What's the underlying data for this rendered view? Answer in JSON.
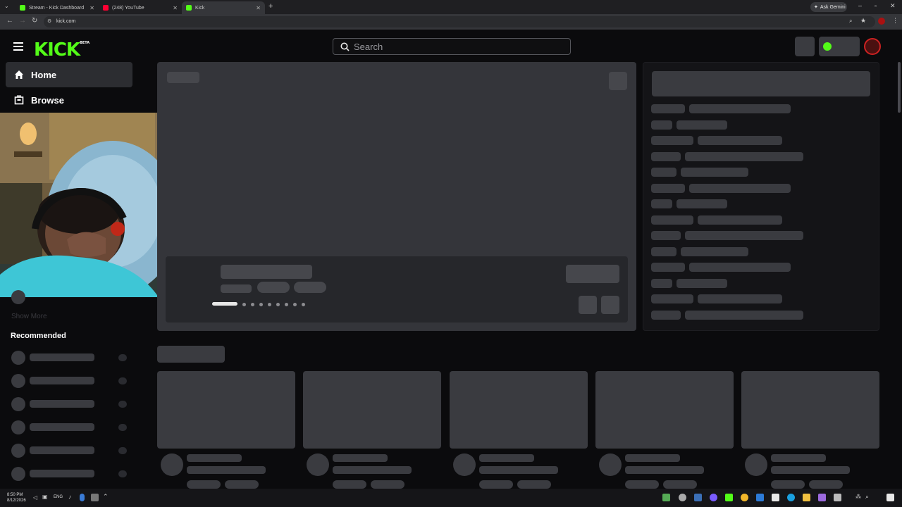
{
  "browser": {
    "tabs": [
      {
        "title": "Stream - Kick Dashboard",
        "fav_color": "#53fc18"
      },
      {
        "title": "(248) YouTube",
        "fav_color": "#ff0033"
      },
      {
        "title": "Kick",
        "fav_color": "#53fc18"
      }
    ],
    "new_tab": "+",
    "ask_gemini": "Ask Gemini",
    "url": "kick.com"
  },
  "site": {
    "logo": "KICK",
    "logo_badge": "BETA",
    "search_placeholder": "Search",
    "nav": [
      {
        "label": "Home"
      },
      {
        "label": "Browse"
      }
    ],
    "recommended_title": "Recommended",
    "show_more": "Show More",
    "accent_color": "#53fc18"
  },
  "taskbar": {
    "time": "8:50 PM",
    "date": "8/12/2026",
    "lang": "ENG"
  }
}
